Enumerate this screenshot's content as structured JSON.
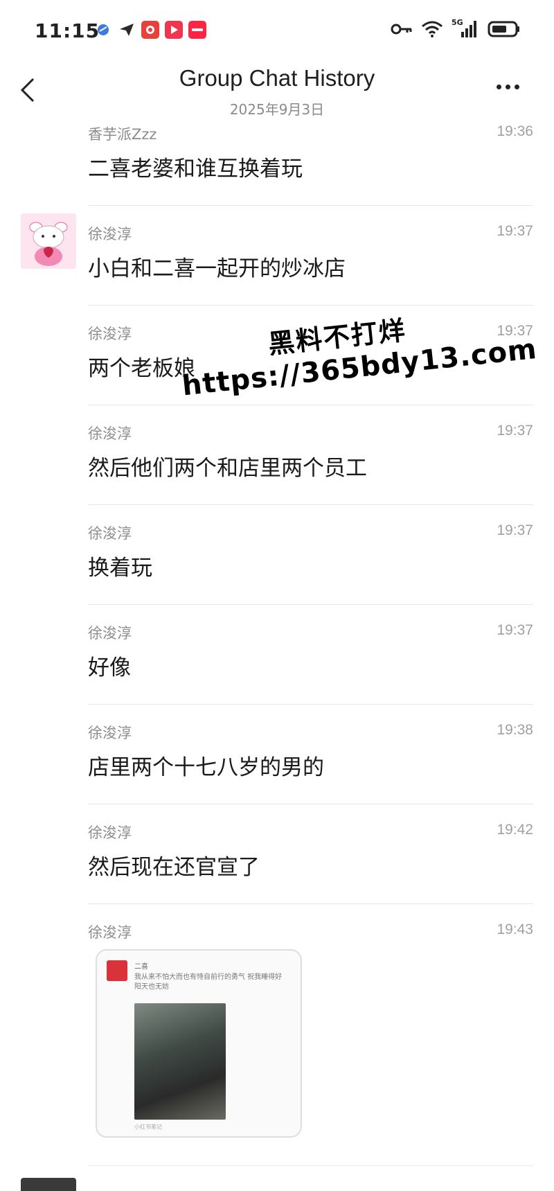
{
  "status_bar": {
    "time": "11:15",
    "network": "5G"
  },
  "header": {
    "title": "Group Chat History",
    "subtitle": "2025年9月3日"
  },
  "messages": [
    {
      "sender": "香芋派Zzz",
      "time": "19:36",
      "text": "二喜老婆和谁互换着玩"
    },
    {
      "sender": "徐浚淳",
      "time": "19:37",
      "text": "小白和二喜一起开的炒冰店"
    },
    {
      "sender": "徐浚淳",
      "time": "19:37",
      "text": "两个老板娘"
    },
    {
      "sender": "徐浚淳",
      "time": "19:37",
      "text": "然后他们两个和店里两个员工"
    },
    {
      "sender": "徐浚淳",
      "time": "19:37",
      "text": "换着玩"
    },
    {
      "sender": "徐浚淳",
      "time": "19:37",
      "text": "好像"
    },
    {
      "sender": "徐浚淳",
      "time": "19:38",
      "text": "店里两个十七八岁的男的"
    },
    {
      "sender": "徐浚淳",
      "time": "19:42",
      "text": "然后现在还官宣了"
    },
    {
      "sender": "徐浚淳",
      "time": "19:43",
      "text": ""
    }
  ],
  "shared_card": {
    "name": "二喜",
    "text": "我从来不怕大而也有恃自前行的勇气 祝我睡得好 阳天也无妨",
    "footer": "小红书笔记"
  },
  "watermark": {
    "line1": "黑料不打烊",
    "line2": "https://365bdy13.com"
  }
}
